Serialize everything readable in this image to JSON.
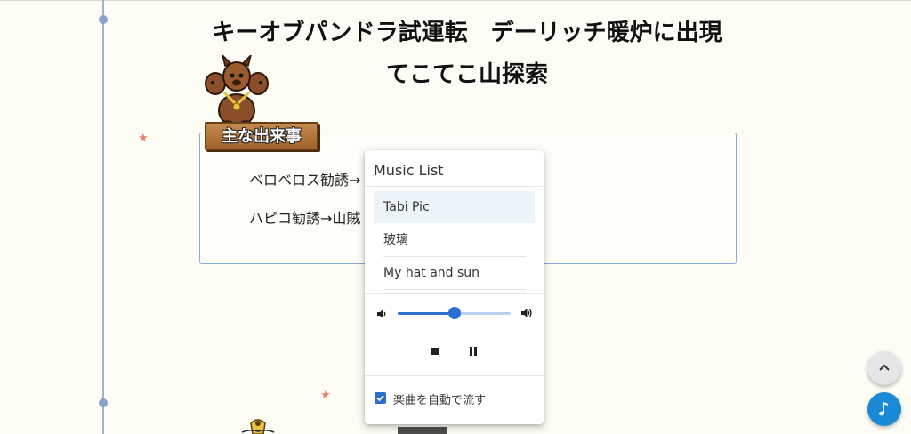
{
  "page": {
    "title_line1": "キーオブパンドラ試運転　デーリッチ暖炉に出現",
    "title_line2": "てこてこ山探索"
  },
  "events": {
    "label": "主な出来事",
    "items": [
      "ベロベロス勧誘→",
      "ハピコ勧誘→山賊"
    ]
  },
  "music": {
    "title": "Music List",
    "tracks": [
      "Tabi Pic",
      "玻璃",
      "My hat and sun"
    ],
    "selected_index": 0,
    "volume": 0.5,
    "autoplay_label": "楽曲を自動で流す",
    "autoplay_checked": true
  },
  "colors": {
    "accent": "#2a6fd0",
    "fab_music": "#1a8ad6",
    "box_border": "#88a8d6",
    "star": "#e97f6e"
  },
  "icons": {
    "star": "star-icon",
    "volume_down": "volume-down-icon",
    "volume_up": "volume-up-icon",
    "stop": "stop-icon",
    "pause": "pause-icon",
    "check": "check-icon",
    "scroll_top": "chevron-up-icon",
    "music": "music-note-icon"
  }
}
